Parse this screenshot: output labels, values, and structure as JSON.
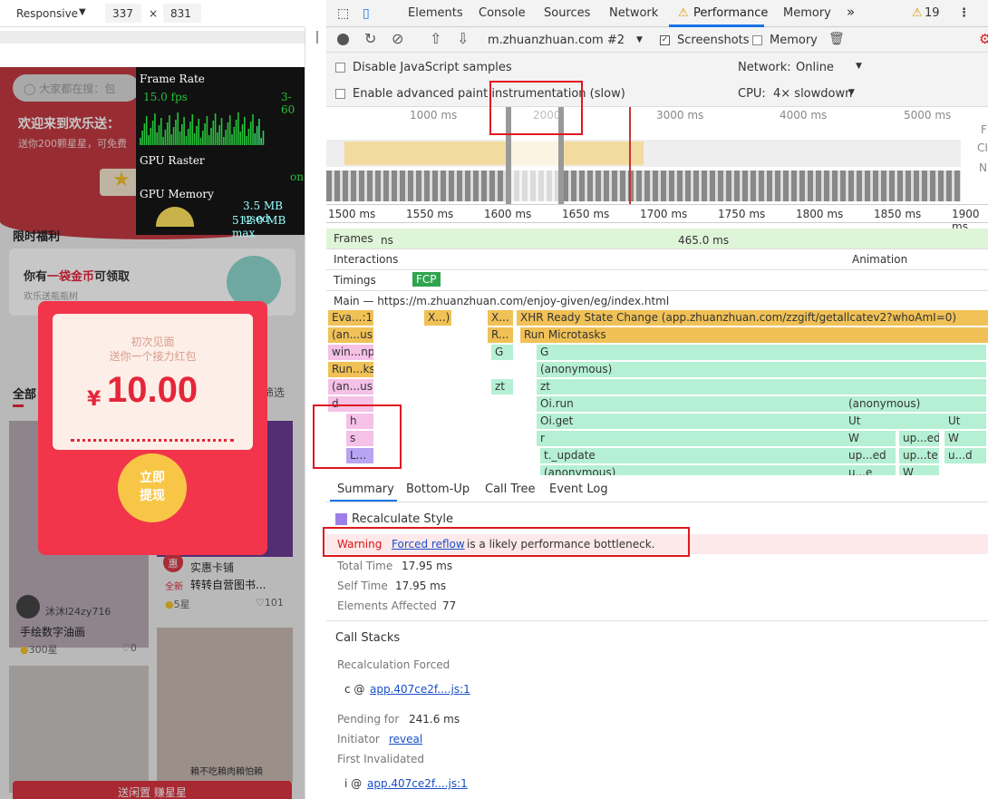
{
  "device_bar": {
    "mode": "Responsive",
    "width": "337",
    "times": "×",
    "height": "831"
  },
  "mobile": {
    "search_placeholder": "大家都在搜：包",
    "welcome": "欢迎来到欢乐送：",
    "welcome_sub": "送你200颗星星，可免费",
    "section_limited": "限时福利",
    "gold_title_a": "你有",
    "gold_title_b": "一袋金币",
    "gold_title_c": "可领取",
    "gold_sub": "欢乐送瓶瓶树",
    "tab_all": "全部",
    "tab_filter": "筛选",
    "red_packet": {
      "line1": "初次见面",
      "line2": "送你一个接力红包",
      "currency": "¥",
      "amount": "10.00",
      "button": "立即\n提现"
    },
    "shop_badge": "惠",
    "shop_name": "实惠卡铺",
    "item1": {
      "user": "沐沐l24zy716",
      "title": "手绘数字油画",
      "stars": "300星",
      "likes": "0"
    },
    "item2": {
      "tag": "全新",
      "title": "转转自营图书...",
      "stars": "5星",
      "likes": "101"
    },
    "item3_user": "賴不吃賴肉賴怕賴",
    "bottom_bar": "送闲置 赚星星"
  },
  "fps_meter": {
    "title": "Frame Rate",
    "fps": "15.0 fps",
    "range": "3-60",
    "raster": "GPU Raster",
    "raster_state": "on",
    "memory": "GPU Memory",
    "used": "3.5 MB used",
    "max": "512.0 MB max"
  },
  "devtools": {
    "tabs": [
      "Elements",
      "Console",
      "Sources",
      "Network",
      "Performance",
      "Memory"
    ],
    "more": "»",
    "warnings": "19",
    "url_select": "m.zhuanzhuan.com #2",
    "screenshots": "Screenshots",
    "memory_chk": "Memory",
    "opt_js": "Disable JavaScript samples",
    "opt_paint": "Enable advanced paint instrumentation (slow)",
    "network_lbl": "Network:",
    "network_val": "Online",
    "cpu_lbl": "CPU:",
    "cpu_val": "4× slowdown",
    "overview_ticks": [
      "1000 ms",
      "2000",
      "3000 ms",
      "4000 ms",
      "5000 ms"
    ],
    "overview_side": [
      "F",
      "CI",
      "N"
    ],
    "ruler_ticks": [
      "1500 ms",
      "1550 ms",
      "1600 ms",
      "1650 ms",
      "1700 ms",
      "1750 ms",
      "1800 ms",
      "1850 ms",
      "1900 ms"
    ],
    "frames_lbl": "Frames",
    "frames_ms": "ns",
    "frames_dur": "465.0 ms",
    "interactions": "Interactions",
    "animation": "Animation",
    "timings": "Timings",
    "fcp": "FCP",
    "main": "Main — https://m.zhuanzhuan.com/enjoy-given/eg/index.html",
    "flame_left": [
      "Eva...:1)",
      "(an...us)",
      "win...np",
      "Run...ks",
      "(an...us)",
      "d",
      "h",
      "s",
      "L..."
    ],
    "flame_x1": "X...)",
    "flame_x2": "X...",
    "flame_r": "R...",
    "flame_g": "G",
    "flame_zt": "zt",
    "xhr": "XHR Ready State Change (app.zhuanzhuan.com/zzgift/getallcatev2?whoAmI=0)",
    "microtasks": "Run Microtasks",
    "stack": [
      "G",
      "(anonymous)",
      "zt",
      "Oi.run",
      "Oi.get",
      "r",
      "t._update",
      "(anonymous)"
    ],
    "right_stack": [
      "(anonymous)",
      "Ut",
      "W",
      "up...ed",
      "u...e"
    ],
    "right_stack2": [
      "Ut",
      "W",
      "up...ed",
      "up...te"
    ],
    "right_stack3": [
      "W",
      "u...d"
    ],
    "summary_tabs": [
      "Summary",
      "Bottom-Up",
      "Call Tree",
      "Event Log"
    ],
    "event_name": "Recalculate Style",
    "warning_lbl": "Warning",
    "warning_link": "Forced reflow",
    "warning_text": "is a likely performance bottleneck.",
    "total_time_lbl": "Total Time",
    "total_time": "17.95 ms",
    "self_time_lbl": "Self Time",
    "self_time": "17.95 ms",
    "elements_lbl": "Elements Affected",
    "elements": "77",
    "call_stacks": "Call Stacks",
    "recalc_forced": "Recalculation Forced",
    "c_fn": "c @",
    "c_link": "app.407ce2f....js:1",
    "pending_lbl": "Pending for",
    "pending": "241.6 ms",
    "initiator_lbl": "Initiator",
    "initiator": "reveal",
    "first_inv": "First Invalidated",
    "i_fn": "i @",
    "i_link": "app.407ce2f....js:1"
  }
}
